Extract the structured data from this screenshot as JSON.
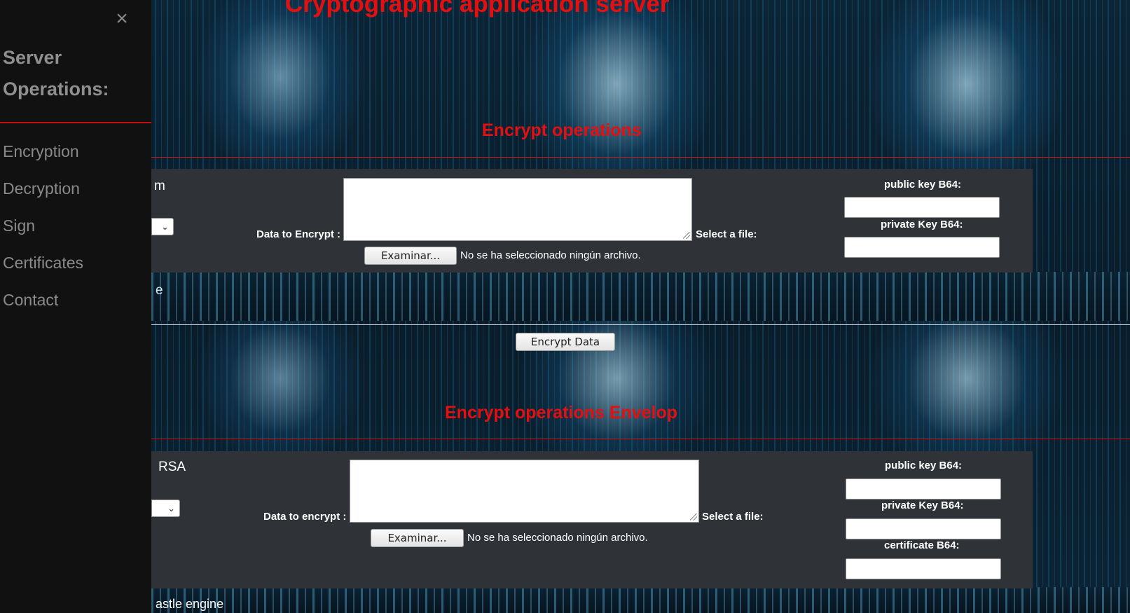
{
  "page": {
    "title": "Cryptographic application server"
  },
  "sidebar": {
    "close_icon": "×",
    "title": "Server Operations:",
    "items": [
      {
        "label": "Encryption"
      },
      {
        "label": "Decryption"
      },
      {
        "label": "Sign"
      },
      {
        "label": "Certificates"
      },
      {
        "label": "Contact"
      }
    ]
  },
  "encrypt": {
    "title": "Encrypt operations",
    "partial_label": "m",
    "partial_label_below": "e",
    "data_label": "Data to Encrypt :",
    "select_file_label": "Select a file:",
    "browse_button": "Examinar...",
    "no_file_text": "No se ha seleccionado ningún archivo.",
    "public_key_label": "public key B64:",
    "private_key_label": "private Key B64:",
    "submit_button": "Encrypt Data",
    "dropdown_icon": "chevron-down-icon"
  },
  "envelop": {
    "title": "Encrypt operations Envelop",
    "partial_label": "RSA",
    "data_label": "Data to encrypt :",
    "select_file_label": "Select a file:",
    "browse_button": "Examinar...",
    "no_file_text": "No se ha seleccionado ningún archivo.",
    "public_key_label": "public key B64:",
    "private_key_label": "private Key B64:",
    "certificate_label": "certificate B64:",
    "footer_partial": "astle engine",
    "dropdown_icon": "chevron-down-icon"
  },
  "colors": {
    "accent_red": "#e50f0f",
    "sidebar_bg": "#111111",
    "panel_bg": "#2f3338"
  }
}
